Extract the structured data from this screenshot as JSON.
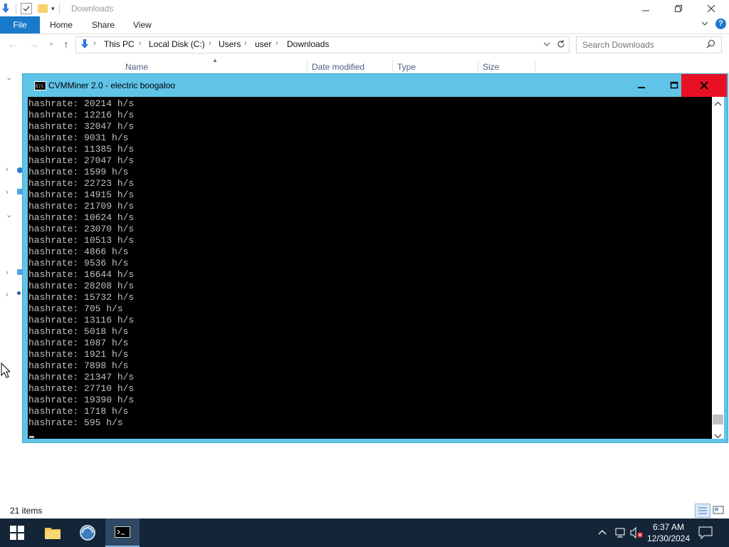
{
  "explorer": {
    "window_title": "Downloads",
    "ribbon_tabs": [
      "File",
      "Home",
      "Share",
      "View"
    ],
    "breadcrumb": [
      "This PC",
      "Local Disk (C:)",
      "Users",
      "user",
      "Downloads"
    ],
    "search_placeholder": "Search Downloads",
    "columns": [
      "Name",
      "Date modified",
      "Type",
      "Size"
    ],
    "status": "21 items"
  },
  "cmd": {
    "title": "CVMMiner 2.0 - electric boogaloo",
    "lines": [
      "hashrate: 20214 h/s",
      "hashrate: 12216 h/s",
      "hashrate: 32047 h/s",
      "hashrate: 9031 h/s",
      "hashrate: 11385 h/s",
      "hashrate: 27047 h/s",
      "hashrate: 1599 h/s",
      "hashrate: 22723 h/s",
      "hashrate: 14915 h/s",
      "hashrate: 21709 h/s",
      "hashrate: 10624 h/s",
      "hashrate: 23070 h/s",
      "hashrate: 10513 h/s",
      "hashrate: 4866 h/s",
      "hashrate: 9536 h/s",
      "hashrate: 16644 h/s",
      "hashrate: 28208 h/s",
      "hashrate: 15732 h/s",
      "hashrate: 705 h/s",
      "hashrate: 13116 h/s",
      "hashrate: 5018 h/s",
      "hashrate: 1087 h/s",
      "hashrate: 1921 h/s",
      "hashrate: 7898 h/s",
      "hashrate: 21347 h/s",
      "hashrate: 27710 h/s",
      "hashrate: 19390 h/s",
      "hashrate: 1718 h/s",
      "hashrate: 595 h/s"
    ]
  },
  "taskbar": {
    "time": "6:37 AM",
    "date": "12/30/2024"
  },
  "colors": {
    "accent": "#1979ca",
    "cmd_frame": "#5fc4e8",
    "close_red": "#e81123",
    "taskbar": "#142538"
  }
}
